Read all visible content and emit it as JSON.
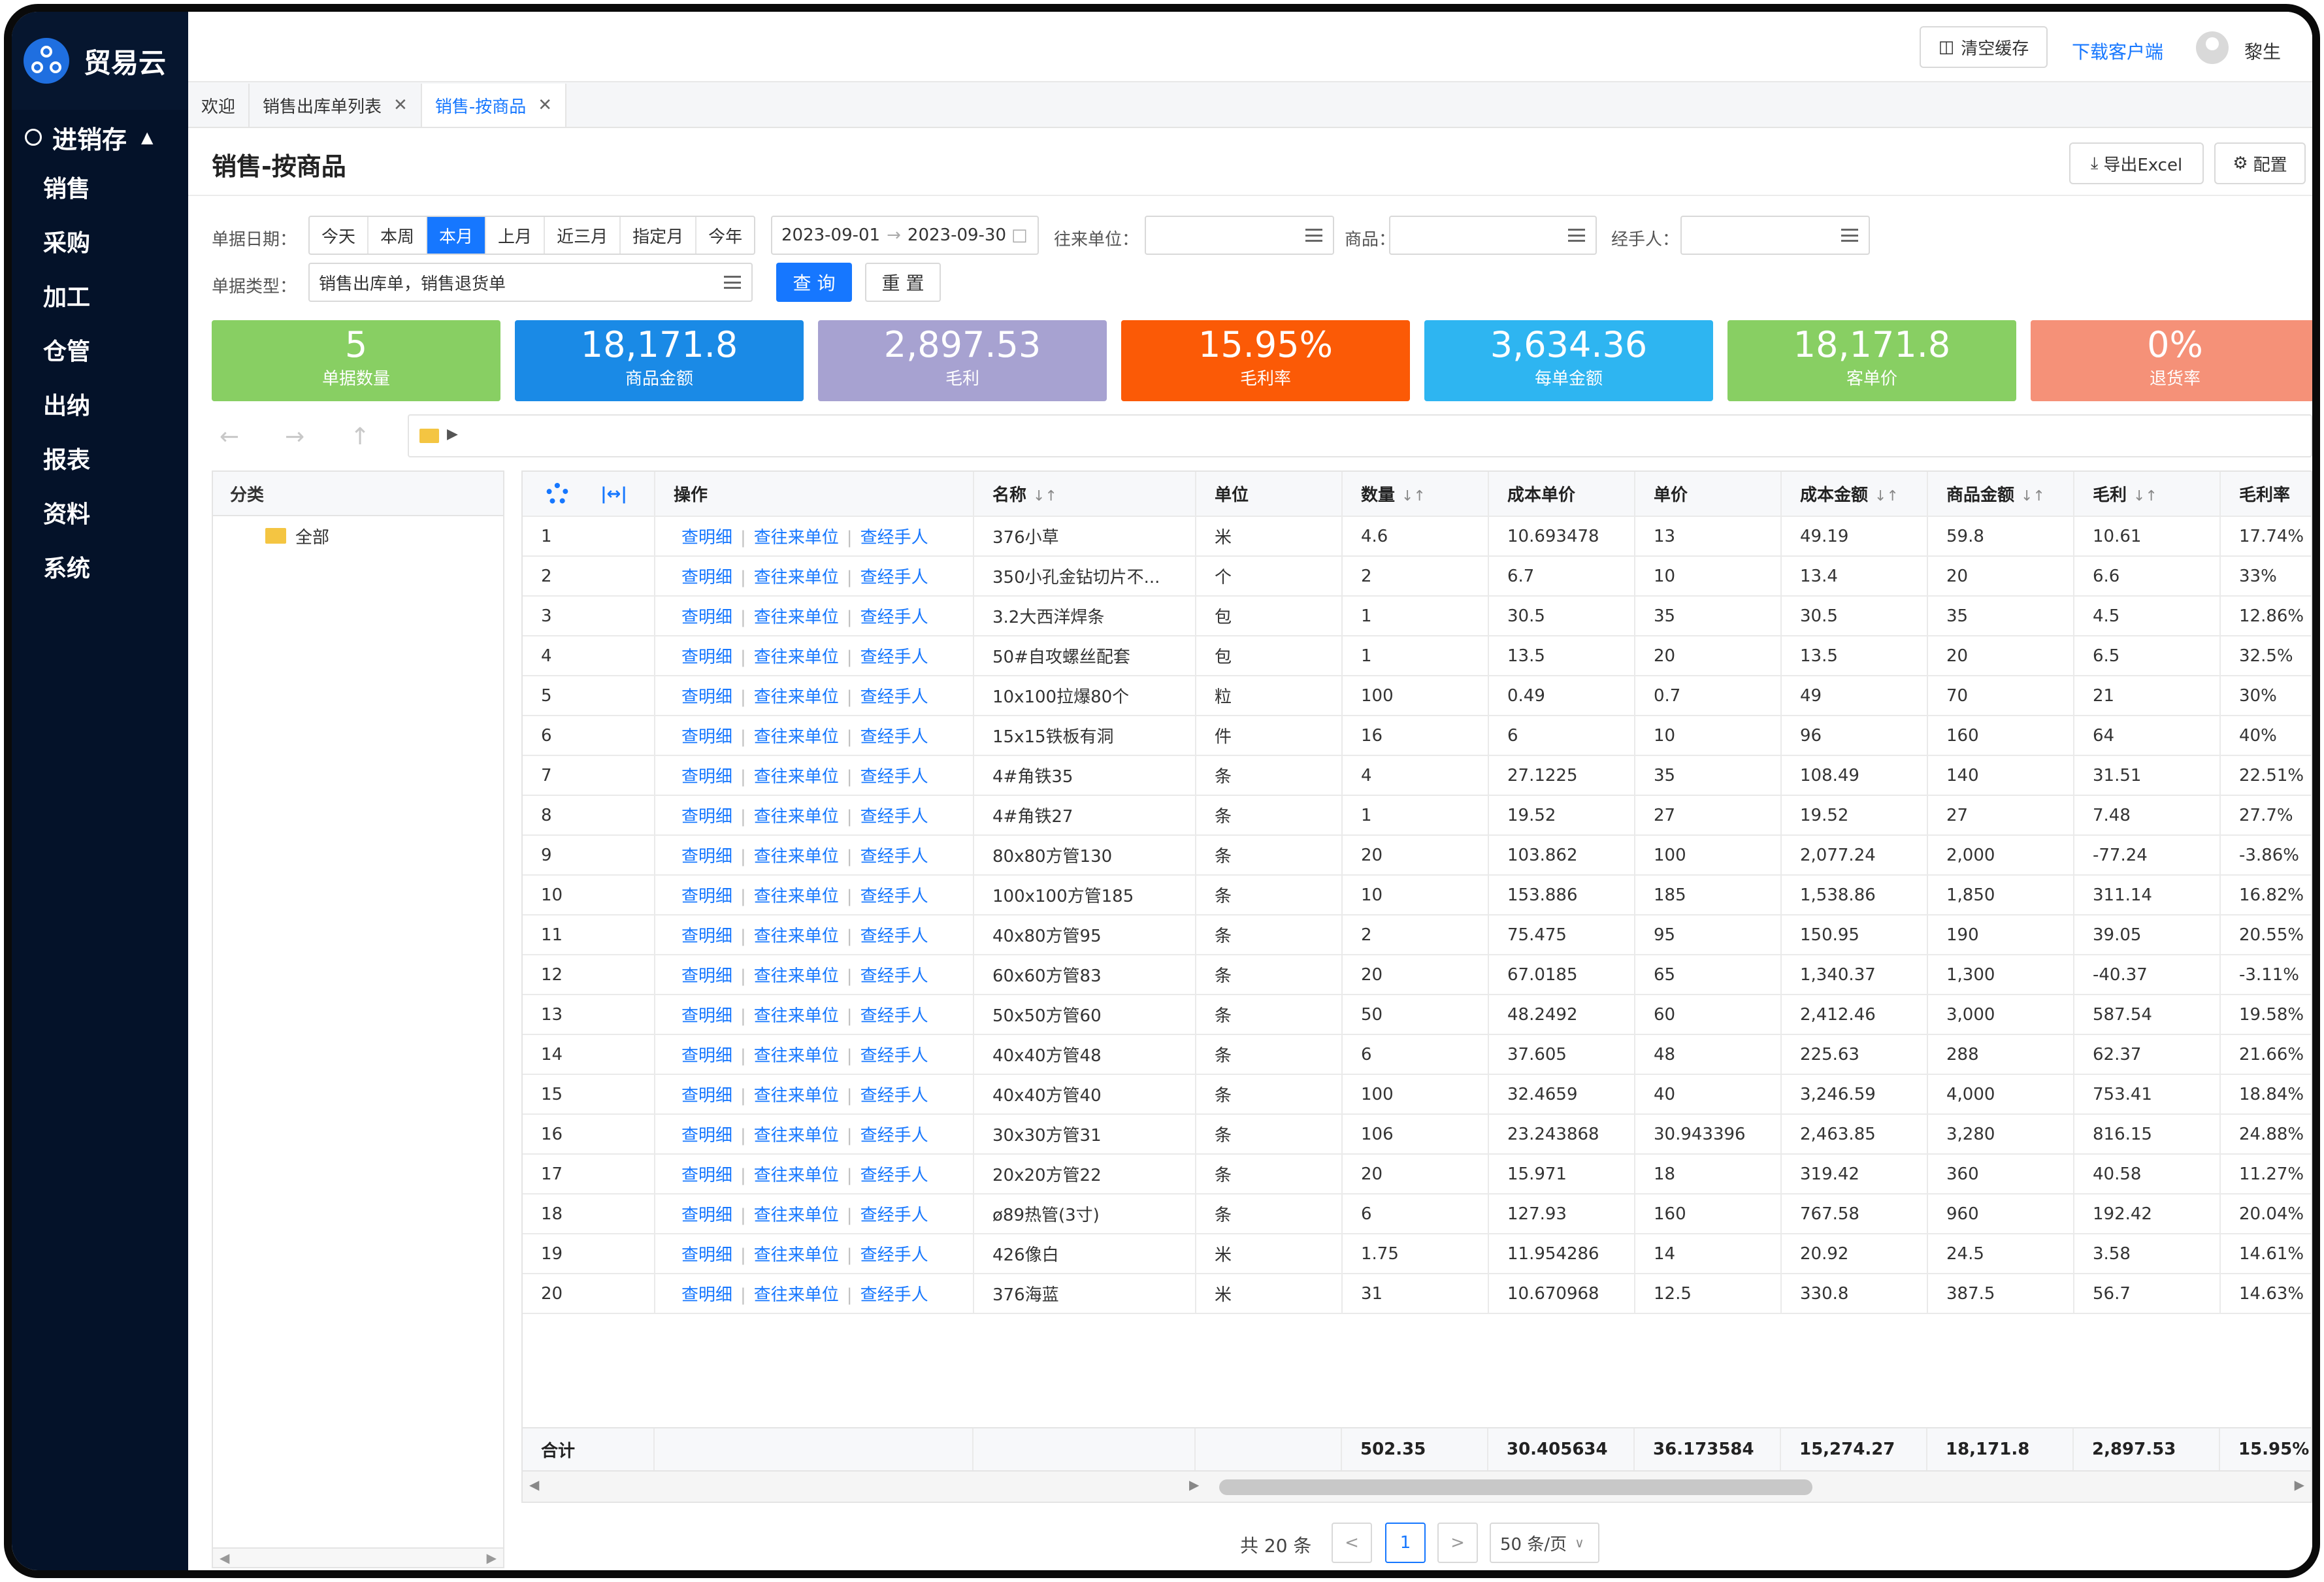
{
  "app": {
    "name": "贸易云"
  },
  "sidebar": {
    "group": "进销存",
    "items": [
      {
        "label": "销售"
      },
      {
        "label": "采购"
      },
      {
        "label": "加工"
      },
      {
        "label": "仓管"
      },
      {
        "label": "出纳"
      },
      {
        "label": "报表"
      },
      {
        "label": "资料"
      },
      {
        "label": "系统"
      }
    ]
  },
  "header": {
    "clear_cache": "清空缓存",
    "download_client": "下载客户端",
    "user": "黎生"
  },
  "tabs": [
    {
      "label": "欢迎"
    },
    {
      "label": "销售出库单列表"
    },
    {
      "label": "销售-按商品"
    }
  ],
  "page": {
    "title": "销售-按商品",
    "export_label": "导出Excel",
    "config_label": "配置"
  },
  "filters": {
    "date_label": "单据日期：",
    "date_options": [
      "今天",
      "本周",
      "本月",
      "上月",
      "近三月",
      "指定月",
      "今年"
    ],
    "date_selected": "本月",
    "date_start": "2023-09-01",
    "date_end": "2023-09-30",
    "partner_label": "往来单位：",
    "goods_label": "商品：",
    "handler_label": "经手人：",
    "type_label": "单据类型：",
    "type_value": "销售出库单，销售退货单",
    "query_label": "查 询",
    "reset_label": "重 置"
  },
  "stats": [
    {
      "value": "5",
      "label": "单据数量",
      "color": "#88cf63"
    },
    {
      "value": "18,171.8",
      "label": "商品金额",
      "color": "#1a8ae6"
    },
    {
      "value": "2,897.53",
      "label": "毛利",
      "color": "#a7a2d1"
    },
    {
      "value": "15.95%",
      "label": "毛利率",
      "color": "#fb5a06"
    },
    {
      "value": "3,634.36",
      "label": "每单金额",
      "color": "#2eb5f1"
    },
    {
      "value": "18,171.8",
      "label": "客单价",
      "color": "#88cf63"
    },
    {
      "value": "0%",
      "label": "退货率",
      "color": "#f59178"
    }
  ],
  "category": {
    "header": "分类",
    "root": "全部"
  },
  "table": {
    "columns": [
      "操作",
      "名称",
      "单位",
      "数量",
      "成本单价",
      "单价",
      "成本金额",
      "商品金额",
      "毛利",
      "毛利率"
    ],
    "actions": [
      "查明细",
      "查往来单位",
      "查经手人"
    ],
    "rows": [
      [
        "1",
        "376小草",
        "米",
        "4.6",
        "10.693478",
        "13",
        "49.19",
        "59.8",
        "10.61",
        "17.74%"
      ],
      [
        "2",
        "350小孔金钻切片不...",
        "个",
        "2",
        "6.7",
        "10",
        "13.4",
        "20",
        "6.6",
        "33%"
      ],
      [
        "3",
        "3.2大西洋焊条",
        "包",
        "1",
        "30.5",
        "35",
        "30.5",
        "35",
        "4.5",
        "12.86%"
      ],
      [
        "4",
        "50#自攻螺丝配套",
        "包",
        "1",
        "13.5",
        "20",
        "13.5",
        "20",
        "6.5",
        "32.5%"
      ],
      [
        "5",
        "10x100拉爆80个",
        "粒",
        "100",
        "0.49",
        "0.7",
        "49",
        "70",
        "21",
        "30%"
      ],
      [
        "6",
        "15x15铁板有洞",
        "件",
        "16",
        "6",
        "10",
        "96",
        "160",
        "64",
        "40%"
      ],
      [
        "7",
        "4#角铁35",
        "条",
        "4",
        "27.1225",
        "35",
        "108.49",
        "140",
        "31.51",
        "22.51%"
      ],
      [
        "8",
        "4#角铁27",
        "条",
        "1",
        "19.52",
        "27",
        "19.52",
        "27",
        "7.48",
        "27.7%"
      ],
      [
        "9",
        "80x80方管130",
        "条",
        "20",
        "103.862",
        "100",
        "2,077.24",
        "2,000",
        "-77.24",
        "-3.86%"
      ],
      [
        "10",
        "100x100方管185",
        "条",
        "10",
        "153.886",
        "185",
        "1,538.86",
        "1,850",
        "311.14",
        "16.82%"
      ],
      [
        "11",
        "40x80方管95",
        "条",
        "2",
        "75.475",
        "95",
        "150.95",
        "190",
        "39.05",
        "20.55%"
      ],
      [
        "12",
        "60x60方管83",
        "条",
        "20",
        "67.0185",
        "65",
        "1,340.37",
        "1,300",
        "-40.37",
        "-3.11%"
      ],
      [
        "13",
        "50x50方管60",
        "条",
        "50",
        "48.2492",
        "60",
        "2,412.46",
        "3,000",
        "587.54",
        "19.58%"
      ],
      [
        "14",
        "40x40方管48",
        "条",
        "6",
        "37.605",
        "48",
        "225.63",
        "288",
        "62.37",
        "21.66%"
      ],
      [
        "15",
        "40x40方管40",
        "条",
        "100",
        "32.4659",
        "40",
        "3,246.59",
        "4,000",
        "753.41",
        "18.84%"
      ],
      [
        "16",
        "30x30方管31",
        "条",
        "106",
        "23.243868",
        "30.943396",
        "2,463.85",
        "3,280",
        "816.15",
        "24.88%"
      ],
      [
        "17",
        "20x20方管22",
        "条",
        "20",
        "15.971",
        "18",
        "319.42",
        "360",
        "40.58",
        "11.27%"
      ],
      [
        "18",
        "ø89热管(3寸)",
        "条",
        "6",
        "127.93",
        "160",
        "767.58",
        "960",
        "192.42",
        "20.04%"
      ],
      [
        "19",
        "426像白",
        "米",
        "1.75",
        "11.954286",
        "14",
        "20.92",
        "24.5",
        "3.58",
        "14.61%"
      ],
      [
        "20",
        "376海蓝",
        "米",
        "31",
        "10.670968",
        "12.5",
        "330.8",
        "387.5",
        "56.7",
        "14.63%"
      ]
    ],
    "totals": {
      "label": "合计",
      "qty": "502.35",
      "cost_price": "30.405634",
      "price": "36.173584",
      "cost_amount": "15,274.27",
      "amount": "18,171.8",
      "profit": "2,897.53",
      "rate": "15.95%"
    }
  },
  "pagination": {
    "total": "共 20 条",
    "current": "1",
    "page_size": "50 条/页"
  }
}
